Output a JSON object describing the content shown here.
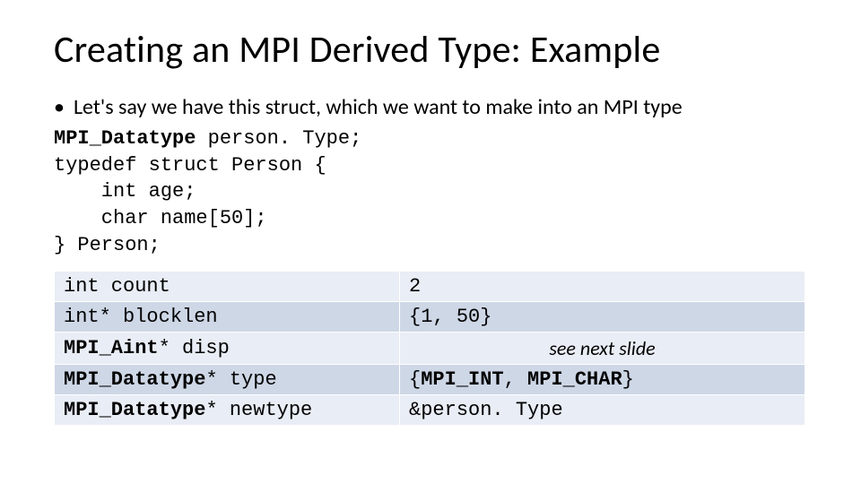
{
  "title": "Creating an MPI Derived Type: Example",
  "bullet": "Let's say we have this struct, which we want to make into an MPI type",
  "code": {
    "l1a": "MPI_Datatype",
    "l1b": " person. Type;",
    "l2": "typedef struct Person {",
    "l3": "    int age;",
    "l4": "    char name[50];",
    "l5": "} Person;"
  },
  "table": {
    "r1": {
      "left": "int count",
      "right": "2"
    },
    "r2": {
      "left": "int* blocklen",
      "right": "{1, 50}"
    },
    "r3": {
      "left_b": "MPI_Aint",
      "left_rest": "* disp",
      "right_note": "see next slide"
    },
    "r4": {
      "left_b": "MPI_Datatype",
      "left_rest": "* type",
      "right_pre": "{",
      "right_b1": "MPI_INT",
      "right_mid": ", ",
      "right_b2": "MPI_CHAR",
      "right_post": "}"
    },
    "r5": {
      "left_b": "MPI_Datatype",
      "left_rest": "* newtype",
      "right": "&person. Type"
    }
  }
}
